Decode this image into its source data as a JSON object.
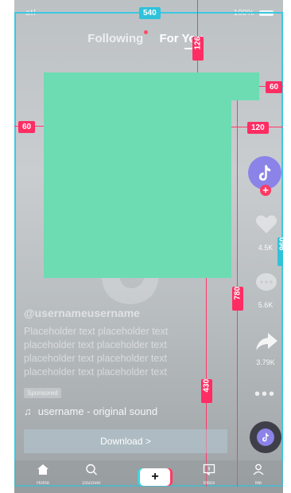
{
  "status_bar": {
    "signal": "atl",
    "battery": "100%"
  },
  "top_tabs": {
    "following": "Following",
    "for_you": "For You"
  },
  "spec": {
    "screen_width": "540",
    "screen_height": "960",
    "top_offset": "126",
    "left_margin": "60",
    "notch_size": "60",
    "right_rail": "120",
    "content_height": "780",
    "caption_height": "430"
  },
  "rail": {
    "like_count": "4.5K",
    "comment_count": "5.6K",
    "share_count": "3.79K",
    "more": "•••"
  },
  "post": {
    "username": "@usernameusername",
    "caption_lines": [
      "Placeholder text placeholder text",
      "placeholder text placeholder text",
      "placeholder text placeholder text",
      "placeholder text  placeholder text"
    ],
    "sponsored": "Sponsored",
    "sound": "username - original sound",
    "download": "Download  >"
  },
  "nav": {
    "home": "Home",
    "discover": "Discover",
    "inbox": "Inbox",
    "me": "Me",
    "create": "+"
  },
  "colors": {
    "accent_pink": "#ff2d63",
    "spec_cyan": "#30c2da",
    "placeholder_green": "#6ddcb3",
    "avatar_purple": "#8b83e8"
  }
}
